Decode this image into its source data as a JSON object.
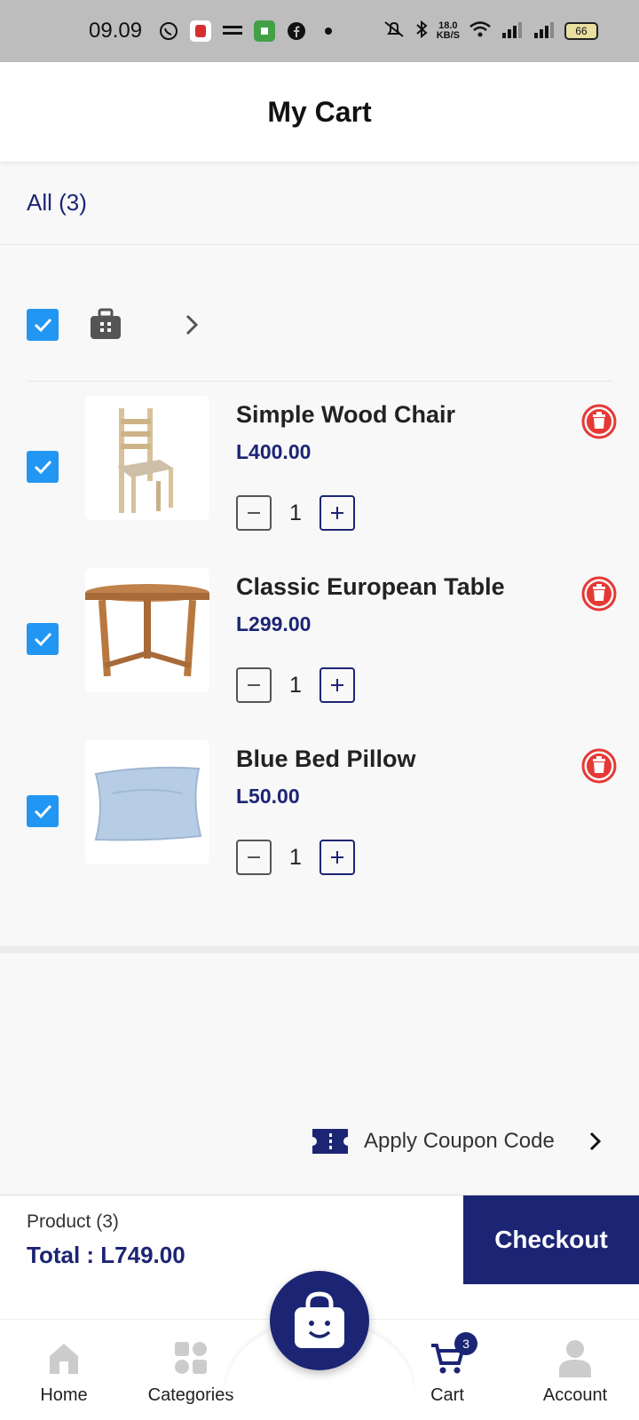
{
  "status_bar": {
    "time": "09.09",
    "net_speed_value": "18.0",
    "net_speed_unit": "KB/S",
    "battery": "66"
  },
  "header": {
    "title": "My Cart"
  },
  "filter": {
    "all_label": "All (3)"
  },
  "cart_items": [
    {
      "name": "Simple Wood Chair",
      "price": "L400.00",
      "quantity": "1"
    },
    {
      "name": "Classic European Table",
      "price": "L299.00",
      "quantity": "1"
    },
    {
      "name": "Blue Bed Pillow",
      "price": "L50.00",
      "quantity": "1"
    }
  ],
  "coupon": {
    "label": "Apply Coupon Code"
  },
  "summary": {
    "product_count": "Product (3)",
    "total": "Total : L749.00",
    "checkout_label": "Checkout"
  },
  "nav": {
    "home": "Home",
    "categories": "Categories",
    "cart": "Cart",
    "account": "Account",
    "cart_badge": "3"
  },
  "colors": {
    "brand": "#1c2574",
    "checkbox": "#2196f3",
    "trash": "#e53935"
  }
}
